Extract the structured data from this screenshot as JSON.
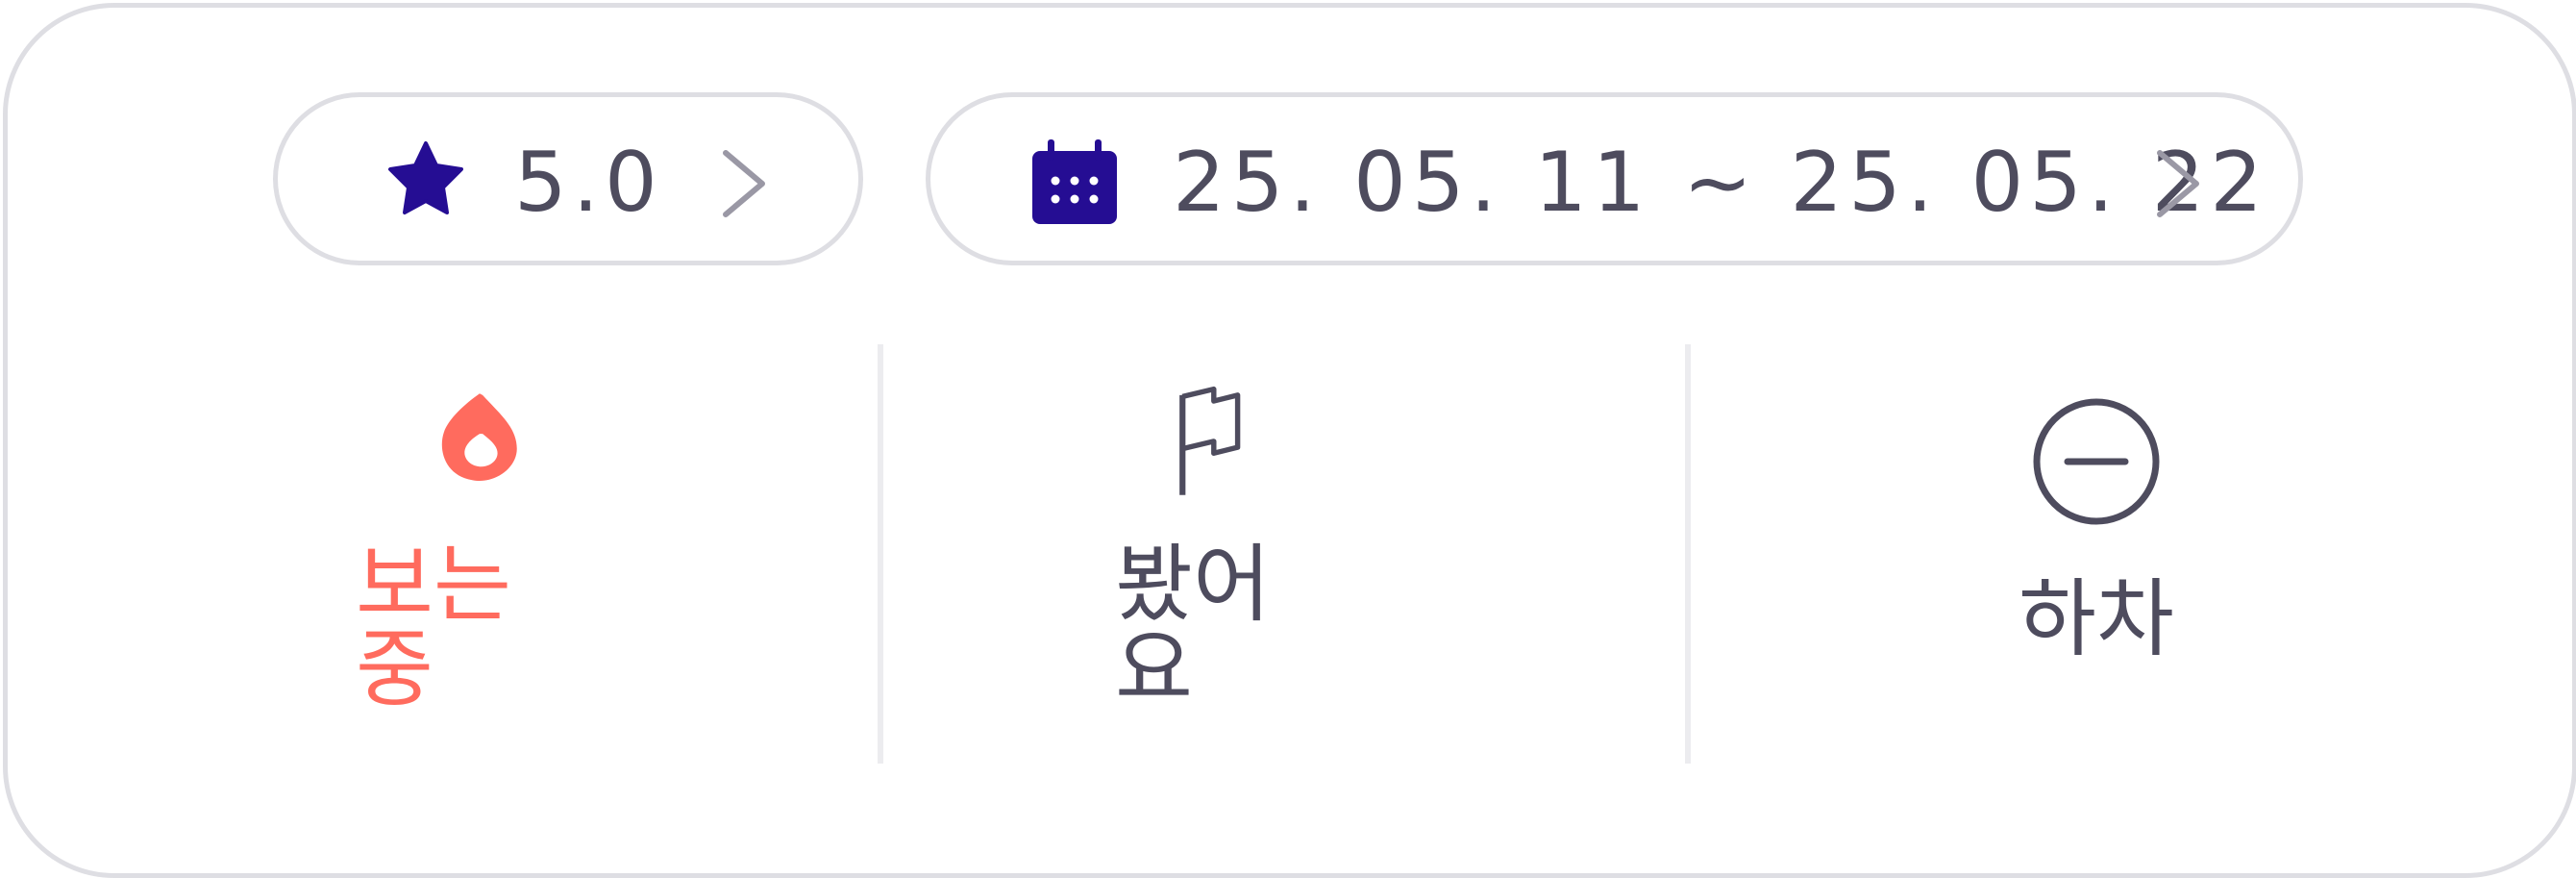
{
  "rating": {
    "value": "5.0",
    "icon": "star-icon",
    "icon_color": "#250d93",
    "chevron": "chevron-right-icon"
  },
  "date_range": {
    "value": "25. 05. 11 ~ 25. 05. 22",
    "icon": "calendar-icon",
    "icon_color": "#250d93",
    "chevron": "chevron-right-icon"
  },
  "status_options": [
    {
      "label": "보는 중",
      "icon": "flame-icon",
      "selected": true,
      "color": "#ff6b5e"
    },
    {
      "label": "봤어요",
      "icon": "flag-icon",
      "selected": false,
      "color": "#4e4c5e"
    },
    {
      "label": "하차",
      "icon": "minus-circle-icon",
      "selected": false,
      "color": "#4e4c5e"
    }
  ]
}
